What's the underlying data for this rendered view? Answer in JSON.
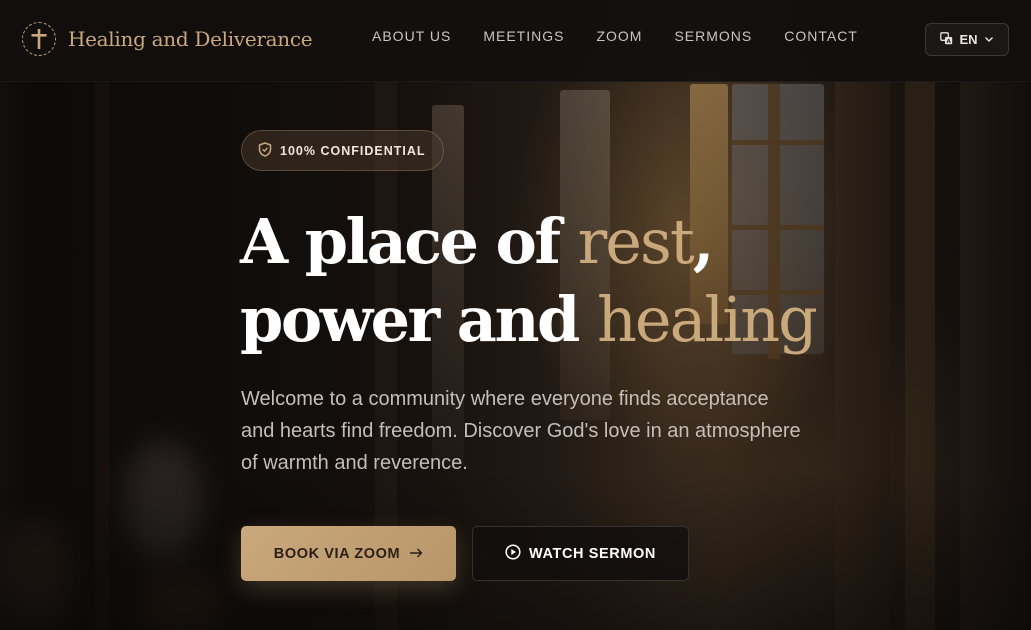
{
  "brand": {
    "name": "Healing and Deliverance",
    "logo_icon": "cross-icon",
    "accent_color": "#c9a87c"
  },
  "nav": {
    "items": [
      "ABOUT US",
      "MEETINGS",
      "ZOOM",
      "SERMONS",
      "CONTACT"
    ]
  },
  "language": {
    "label": "EN",
    "icon": "translate-icon",
    "chevron_icon": "chevron-down-icon"
  },
  "hero": {
    "badge": "100% CONFIDENTIAL",
    "badge_icon": "shield-icon",
    "headline": {
      "line1_plain": "A place of ",
      "line1_accent": "rest",
      "line1_end": ",",
      "line2_plain": "power and ",
      "line2_accent": "healing"
    },
    "intro": "Welcome to a community where everyone finds acceptance and hearts find freedom. Discover God's love in an atmosphere of warmth and reverence."
  },
  "buttons": {
    "zoom": {
      "label": "BOOK VIA ZOOM",
      "icon": "arrow-right-icon"
    },
    "sermon": {
      "label": "WATCH SERMON",
      "icon": "play-circle-icon"
    }
  },
  "colors": {
    "accent": "#c9a87c",
    "header_bg": "#120f0e",
    "body_text": "#c5beb7"
  }
}
